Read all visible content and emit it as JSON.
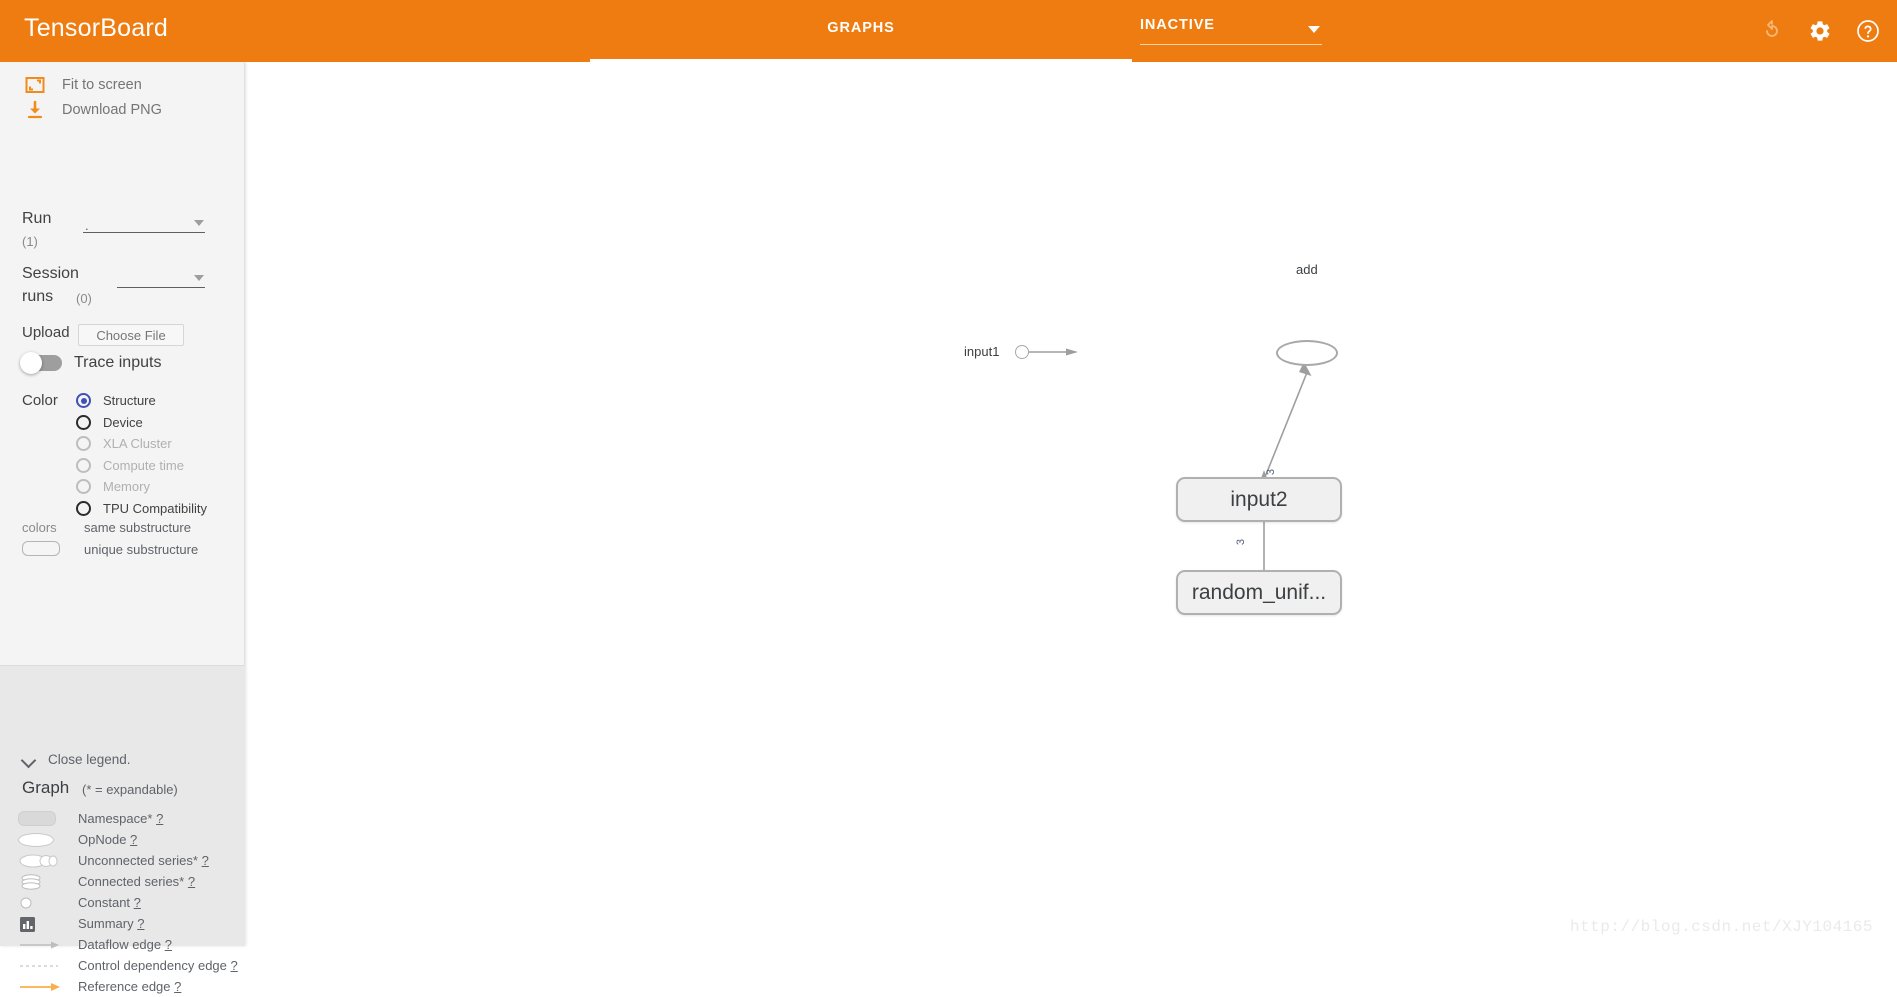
{
  "app": {
    "brand": "TensorBoard",
    "accent_color": "#ef7c10"
  },
  "header": {
    "tabs": [
      {
        "label": "GRAPHS",
        "active": true
      }
    ],
    "run_selector": {
      "value": "INACTIVE",
      "caret_icon": "caret-down-icon"
    },
    "icons": [
      {
        "name": "refresh-icon",
        "state": "disabled"
      },
      {
        "name": "gear-icon",
        "state": "enabled"
      },
      {
        "name": "help-icon",
        "state": "enabled"
      }
    ]
  },
  "sidebar": {
    "actions": [
      {
        "icon": "fit-to-screen-icon",
        "label": "Fit to screen"
      },
      {
        "icon": "download-icon",
        "label": "Download PNG"
      }
    ],
    "run": {
      "label": "Run",
      "count": "(1)",
      "value": "."
    },
    "session_runs": {
      "label": "Session",
      "label2": "runs",
      "count": "(0)",
      "value": ""
    },
    "upload": {
      "label": "Upload",
      "button_label": "Choose File"
    },
    "trace_inputs": {
      "label": "Trace inputs",
      "enabled": false
    },
    "color": {
      "label": "Color",
      "options": [
        {
          "label": "Structure",
          "selected": true,
          "disabled": false
        },
        {
          "label": "Device",
          "selected": false,
          "disabled": false
        },
        {
          "label": "XLA Cluster",
          "selected": false,
          "disabled": true
        },
        {
          "label": "Compute time",
          "selected": false,
          "disabled": true
        },
        {
          "label": "Memory",
          "selected": false,
          "disabled": true
        },
        {
          "label": "TPU Compatibility",
          "selected": false,
          "disabled": false
        }
      ],
      "key_label": "colors",
      "key_same": "same substructure",
      "key_unique": "unique substructure"
    }
  },
  "legend": {
    "close_label": "Close legend.",
    "title": "Graph",
    "note": "(* = expandable)",
    "items": [
      {
        "icon": "namespace-icon",
        "label": "Namespace*",
        "help": "?"
      },
      {
        "icon": "opnode-icon",
        "label": "OpNode",
        "help": "?"
      },
      {
        "icon": "unconnected-series-icon",
        "label": "Unconnected series*",
        "help": "?"
      },
      {
        "icon": "connected-series-icon",
        "label": "Connected series*",
        "help": "?"
      },
      {
        "icon": "constant-icon",
        "label": "Constant",
        "help": "?"
      },
      {
        "icon": "summary-icon",
        "label": "Summary",
        "help": "?"
      },
      {
        "icon": "dataflow-edge-icon",
        "label": "Dataflow edge",
        "help": "?"
      },
      {
        "icon": "control-dependency-edge-icon",
        "label": "Control dependency edge",
        "help": "?"
      },
      {
        "icon": "reference-edge-icon",
        "label": "Reference edge",
        "help": "?"
      }
    ]
  },
  "graph": {
    "nodes": [
      {
        "id": "add",
        "label": "add",
        "type": "opnode"
      },
      {
        "id": "input1",
        "label": "input1",
        "type": "constant"
      },
      {
        "id": "input2",
        "label": "input2",
        "type": "namespace"
      },
      {
        "id": "random_uniform",
        "label": "random_unif...",
        "type": "namespace"
      }
    ],
    "edges": [
      {
        "from": "input1",
        "to": "add",
        "label": ""
      },
      {
        "from": "input2",
        "to": "add",
        "label": "3"
      },
      {
        "from": "random_uniform",
        "to": "input2",
        "label": "3"
      }
    ]
  },
  "watermark": "http://blog.csdn.net/XJY104165"
}
